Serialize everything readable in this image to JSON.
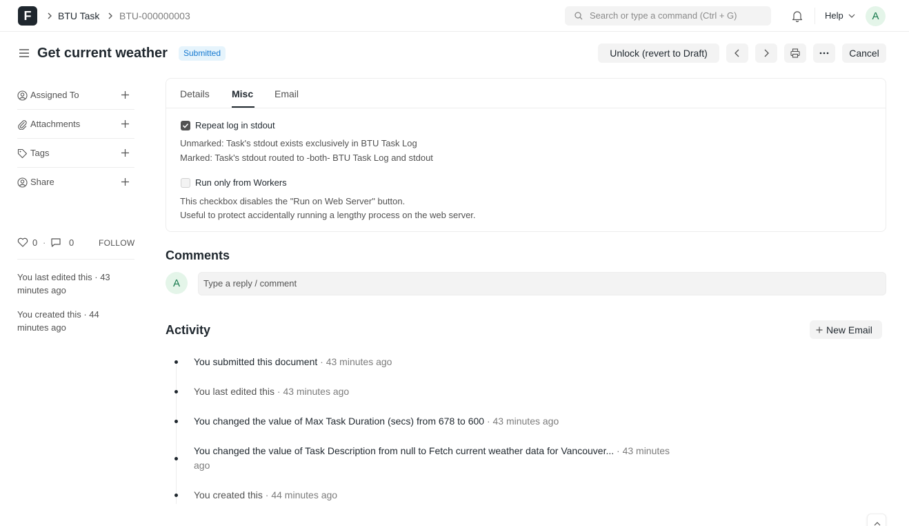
{
  "navbar": {
    "logo_letter": "F",
    "breadcrumbs": [
      "BTU Task",
      "BTU-000000003"
    ],
    "search_placeholder": "Search or type a command (Ctrl + G)",
    "help_label": "Help",
    "avatar_letter": "A"
  },
  "page": {
    "title": "Get current weather",
    "status": "Submitted",
    "buttons": {
      "unlock": "Unlock (revert to Draft)",
      "cancel": "Cancel"
    }
  },
  "sidebar": {
    "items": [
      {
        "label": "Assigned To",
        "icon": "assign-icon"
      },
      {
        "label": "Attachments",
        "icon": "paperclip-icon"
      },
      {
        "label": "Tags",
        "icon": "tag-icon"
      },
      {
        "label": "Share",
        "icon": "share-user-icon"
      }
    ],
    "likes_count": "0",
    "comments_count": "0",
    "follow_label": "FOLLOW",
    "last_edited": "You last edited this · 43 minutes ago",
    "created": "You created this · 44 minutes ago"
  },
  "form": {
    "tabs": [
      "Details",
      "Misc",
      "Email"
    ],
    "active_tab": "Misc",
    "fields": [
      {
        "label": "Repeat log in stdout",
        "checked": true,
        "help": [
          "Unmarked: Task's stdout exists exclusively in BTU Task Log",
          "Marked: Task's stdout routed to -both- BTU Task Log and stdout"
        ]
      },
      {
        "label": "Run only from Workers",
        "checked": false,
        "help": [
          "This checkbox disables the \"Run on Web Server\" button.",
          "Useful to protect accidentally running a lengthy process on the web server."
        ]
      }
    ]
  },
  "comments": {
    "title": "Comments",
    "avatar_letter": "A",
    "placeholder": "Type a reply / comment"
  },
  "activity": {
    "title": "Activity",
    "new_email_label": "New Email",
    "items": [
      {
        "parts": [
          "You submitted this document",
          "· 43 minutes ago"
        ]
      },
      {
        "parts": [
          "You last edited this",
          "· 43 minutes ago"
        ]
      },
      {
        "parts": [
          "You changed the value of ",
          "Max Task Duration (secs)",
          " from ",
          "678",
          " to ",
          "600",
          " · 43 minutes ago"
        ]
      },
      {
        "parts": [
          "You changed the value of ",
          "Task Description",
          " from ",
          "null",
          " to ",
          "Fetch current weather data for Vancouver...",
          " · 43 minutes ago"
        ]
      },
      {
        "parts": [
          "You created this",
          "· 44 minutes ago"
        ]
      }
    ]
  }
}
